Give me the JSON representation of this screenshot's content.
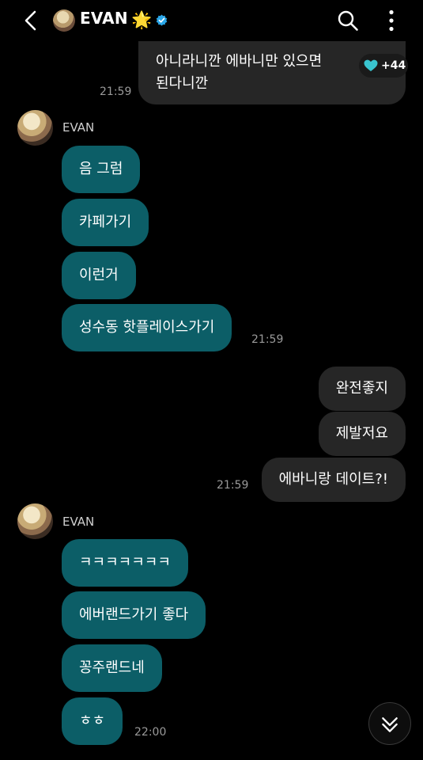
{
  "header": {
    "title": "EVAN",
    "title_emoji": "🌟"
  },
  "top_message": {
    "line1": "아니라니깐 에바니만 있으면",
    "line2": "된다니깐",
    "time": "21:59",
    "reaction_count": "+44"
  },
  "group1": {
    "sender": "EVAN",
    "messages": [
      "음 그럼",
      "카페가기",
      "이런거",
      "성수동 핫플레이스가기"
    ],
    "time": "21:59"
  },
  "my_group": {
    "messages": [
      "완전좋지",
      "제발저요",
      "에바니랑 데이트?!"
    ],
    "time": "21:59"
  },
  "group2": {
    "sender": "EVAN",
    "messages": [
      "ㅋㅋㅋㅋㅋㅋㅋ",
      "에버랜드가기 좋다",
      "꽁주랜드네",
      "ㅎㅎ"
    ],
    "time": "22:00"
  },
  "colors": {
    "incoming_bubble": "#0c5e67",
    "outgoing_bubble": "#262626",
    "verified": "#2aa6e8",
    "heart": "#39c4cf"
  },
  "icons": {
    "back": "chevron-left-icon",
    "search": "search-icon",
    "more": "more-vertical-icon",
    "verified": "verified-badge-icon",
    "reaction": "heart-icon",
    "scroll": "double-chevron-down-icon"
  }
}
